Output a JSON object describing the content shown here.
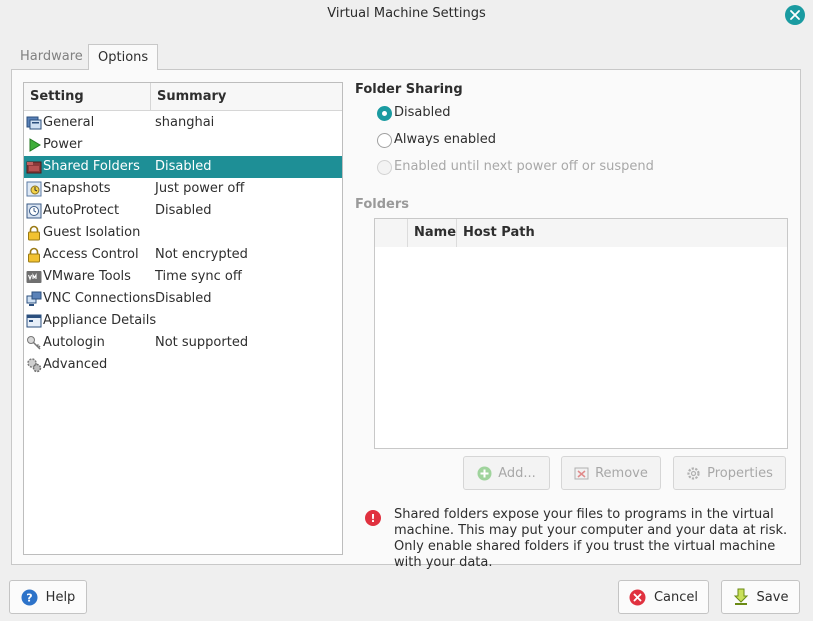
{
  "window": {
    "title": "Virtual Machine Settings"
  },
  "tabs": [
    {
      "label": "Hardware",
      "active": false
    },
    {
      "label": "Options",
      "active": true
    }
  ],
  "settings_list": {
    "headers": {
      "setting": "Setting",
      "summary": "Summary"
    },
    "rows": [
      {
        "name": "General",
        "summary": "shanghai",
        "icon": "general-icon"
      },
      {
        "name": "Power",
        "summary": "",
        "icon": "power-icon"
      },
      {
        "name": "Shared Folders",
        "summary": "Disabled",
        "icon": "shared-folders-icon",
        "selected": true
      },
      {
        "name": "Snapshots",
        "summary": "Just power off",
        "icon": "snapshots-icon"
      },
      {
        "name": "AutoProtect",
        "summary": "Disabled",
        "icon": "autoprotect-icon"
      },
      {
        "name": "Guest Isolation",
        "summary": "",
        "icon": "lock-icon"
      },
      {
        "name": "Access Control",
        "summary": "Not encrypted",
        "icon": "lock-icon"
      },
      {
        "name": "VMware Tools",
        "summary": "Time sync off",
        "icon": "vmware-tools-icon"
      },
      {
        "name": "VNC Connections",
        "summary": "Disabled",
        "icon": "vnc-icon"
      },
      {
        "name": "Appliance Details",
        "summary": "",
        "icon": "appliance-icon"
      },
      {
        "name": "Autologin",
        "summary": "Not supported",
        "icon": "key-icon"
      },
      {
        "name": "Advanced",
        "summary": "",
        "icon": "gears-icon"
      }
    ]
  },
  "folder_sharing": {
    "title": "Folder Sharing",
    "options": [
      {
        "label": "Disabled",
        "checked": true,
        "enabled": true
      },
      {
        "label": "Always enabled",
        "checked": false,
        "enabled": true
      },
      {
        "label": "Enabled until next power off or suspend",
        "checked": false,
        "enabled": false
      }
    ]
  },
  "folders": {
    "title": "Folders",
    "columns": {
      "name": "Name",
      "host_path": "Host Path"
    },
    "buttons": {
      "add": "Add...",
      "remove": "Remove",
      "properties": "Properties"
    }
  },
  "warning": {
    "text": "Shared folders expose your files to programs in the virtual machine. This may put your computer and your data at risk. Only enable shared folders if you trust the virtual machine with your data."
  },
  "footer": {
    "help": "Help",
    "cancel": "Cancel",
    "save": "Save"
  },
  "colors": {
    "accent": "#1e8f96",
    "danger": "#e0313f"
  }
}
